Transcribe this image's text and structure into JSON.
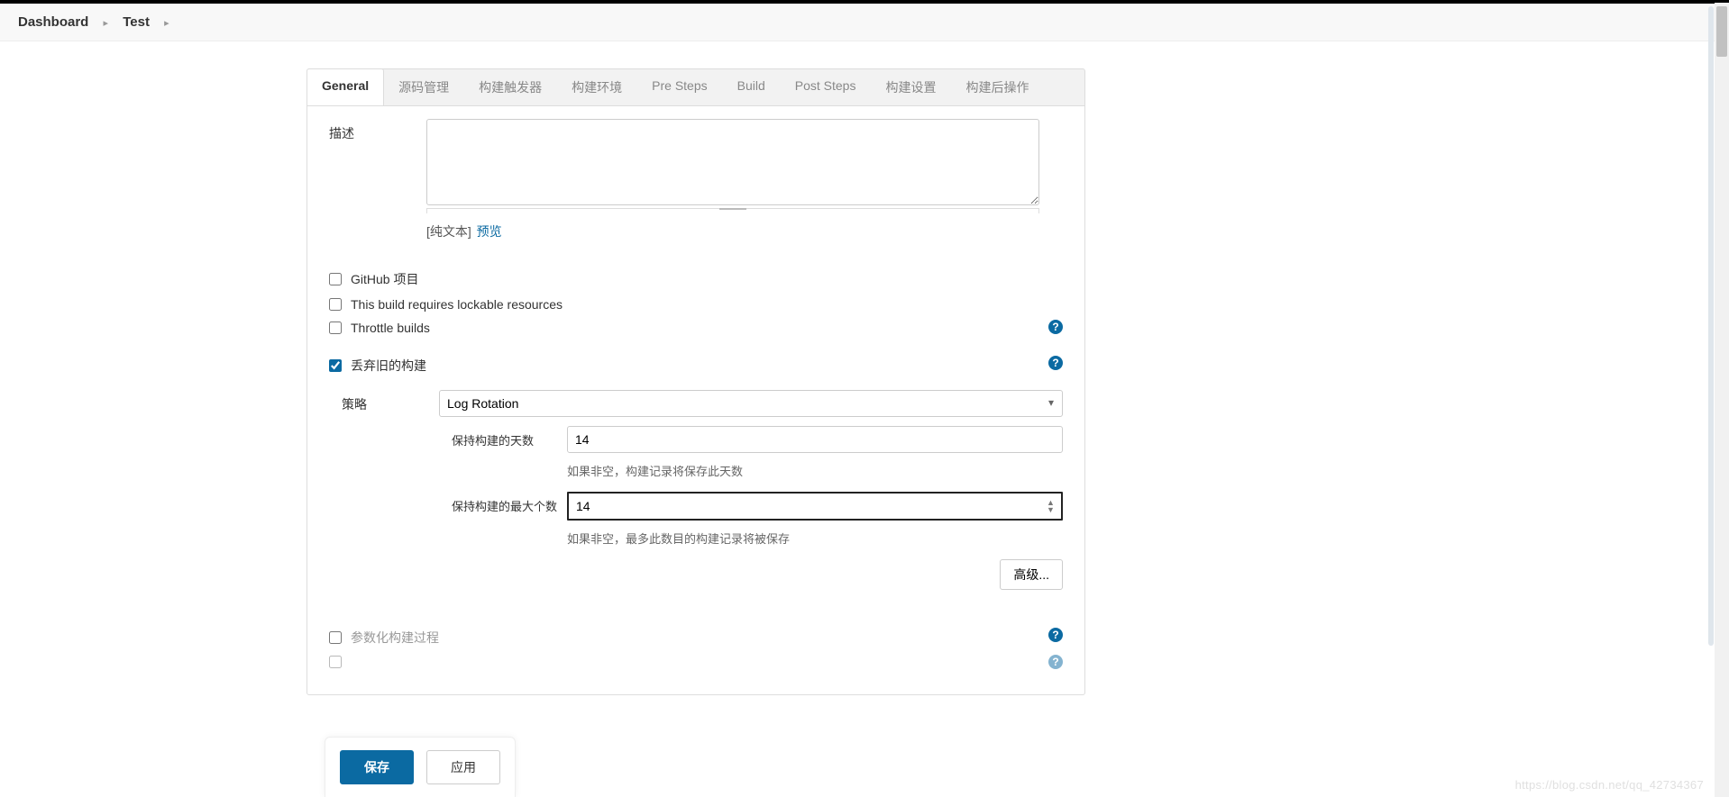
{
  "breadcrumb": {
    "items": [
      "Dashboard",
      "Test"
    ]
  },
  "tabs": {
    "items": [
      {
        "label": "General",
        "active": true
      },
      {
        "label": "源码管理"
      },
      {
        "label": "构建触发器"
      },
      {
        "label": "构建环境"
      },
      {
        "label": "Pre Steps"
      },
      {
        "label": "Build"
      },
      {
        "label": "Post Steps"
      },
      {
        "label": "构建设置"
      },
      {
        "label": "构建后操作"
      }
    ]
  },
  "form": {
    "description_label": "描述",
    "description_value": "",
    "desc_format_prefix": "[纯文本]",
    "desc_preview_link": "预览",
    "checks": {
      "github_label": "GitHub 项目",
      "lockable_label": "This build requires lockable resources",
      "throttle_label": "Throttle builds",
      "discard_label": "丢弃旧的构建",
      "parameterized_label": "参数化构建过程"
    },
    "strategy_label": "策略",
    "strategy_value": "Log Rotation",
    "days_label": "保持构建的天数",
    "days_value": "14",
    "days_hint": "如果非空，构建记录将保存此天数",
    "max_label": "保持构建的最大个数",
    "max_value": "14",
    "max_hint": "如果非空，最多此数目的构建记录将被保存",
    "advanced_label": "高级..."
  },
  "buttons": {
    "save": "保存",
    "apply": "应用"
  },
  "watermark": "https://blog.csdn.net/qq_42734367"
}
